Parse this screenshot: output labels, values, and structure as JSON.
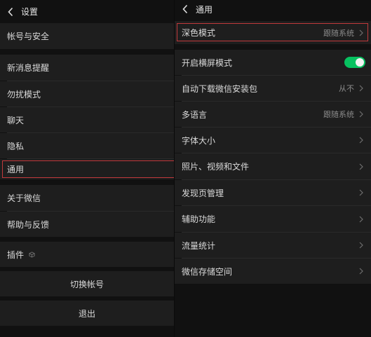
{
  "left": {
    "title": "设置",
    "items": [
      {
        "label": "帐号与安全"
      },
      {
        "label": "新消息提醒"
      },
      {
        "label": "勿扰模式"
      },
      {
        "label": "聊天"
      },
      {
        "label": "隐私"
      },
      {
        "label": "通用"
      },
      {
        "label": "关于微信"
      },
      {
        "label": "帮助与反馈"
      },
      {
        "label": "插件"
      }
    ],
    "switch_account": "切换帐号",
    "logout": "退出"
  },
  "right": {
    "title": "通用",
    "items": [
      {
        "label": "深色模式",
        "value": "跟随系统"
      },
      {
        "label": "开启横屏模式",
        "toggle_on": true
      },
      {
        "label": "自动下载微信安装包",
        "value": "从不"
      },
      {
        "label": "多语言",
        "value": "跟随系统"
      },
      {
        "label": "字体大小"
      },
      {
        "label": "照片、视频和文件"
      },
      {
        "label": "发现页管理"
      },
      {
        "label": "辅助功能"
      },
      {
        "label": "流量统计"
      },
      {
        "label": "微信存储空间"
      }
    ]
  },
  "colors": {
    "background": "#111111",
    "cell": "#1e1e1e",
    "highlight": "#c0393b",
    "toggle": "#07c160"
  }
}
